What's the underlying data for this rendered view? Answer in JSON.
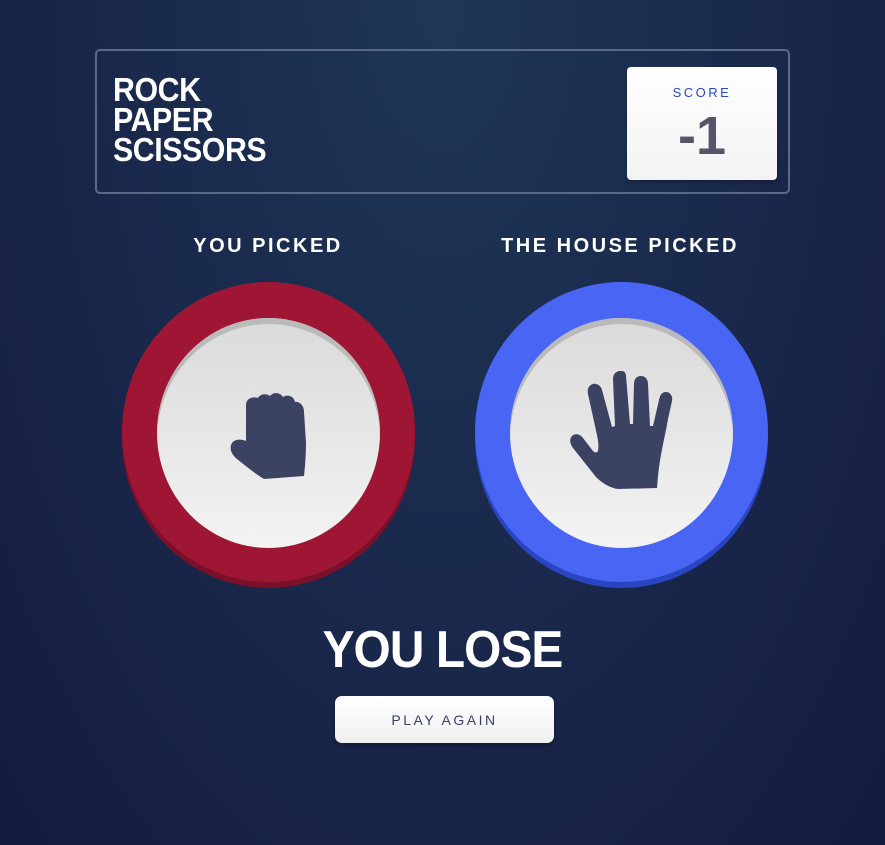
{
  "header": {
    "title_lines": [
      "ROCK",
      "PAPER",
      "SCISSORS"
    ],
    "score_label": "SCORE",
    "score_value": "-1"
  },
  "picks": {
    "you_label": "YOU PICKED",
    "house_label": "THE HOUSE PICKED",
    "you_choice": "rock",
    "house_choice": "paper",
    "you_icon": "rock-fist-icon",
    "house_icon": "paper-hand-icon"
  },
  "result": {
    "text": "YOU LOSE",
    "button_label": "PLAY AGAIN"
  },
  "colors": {
    "rock_ring": "#9f1634",
    "paper_ring": "#4865f4",
    "icon": "#3b4262",
    "score_label": "#2a46c0",
    "score_value": "#565468"
  }
}
